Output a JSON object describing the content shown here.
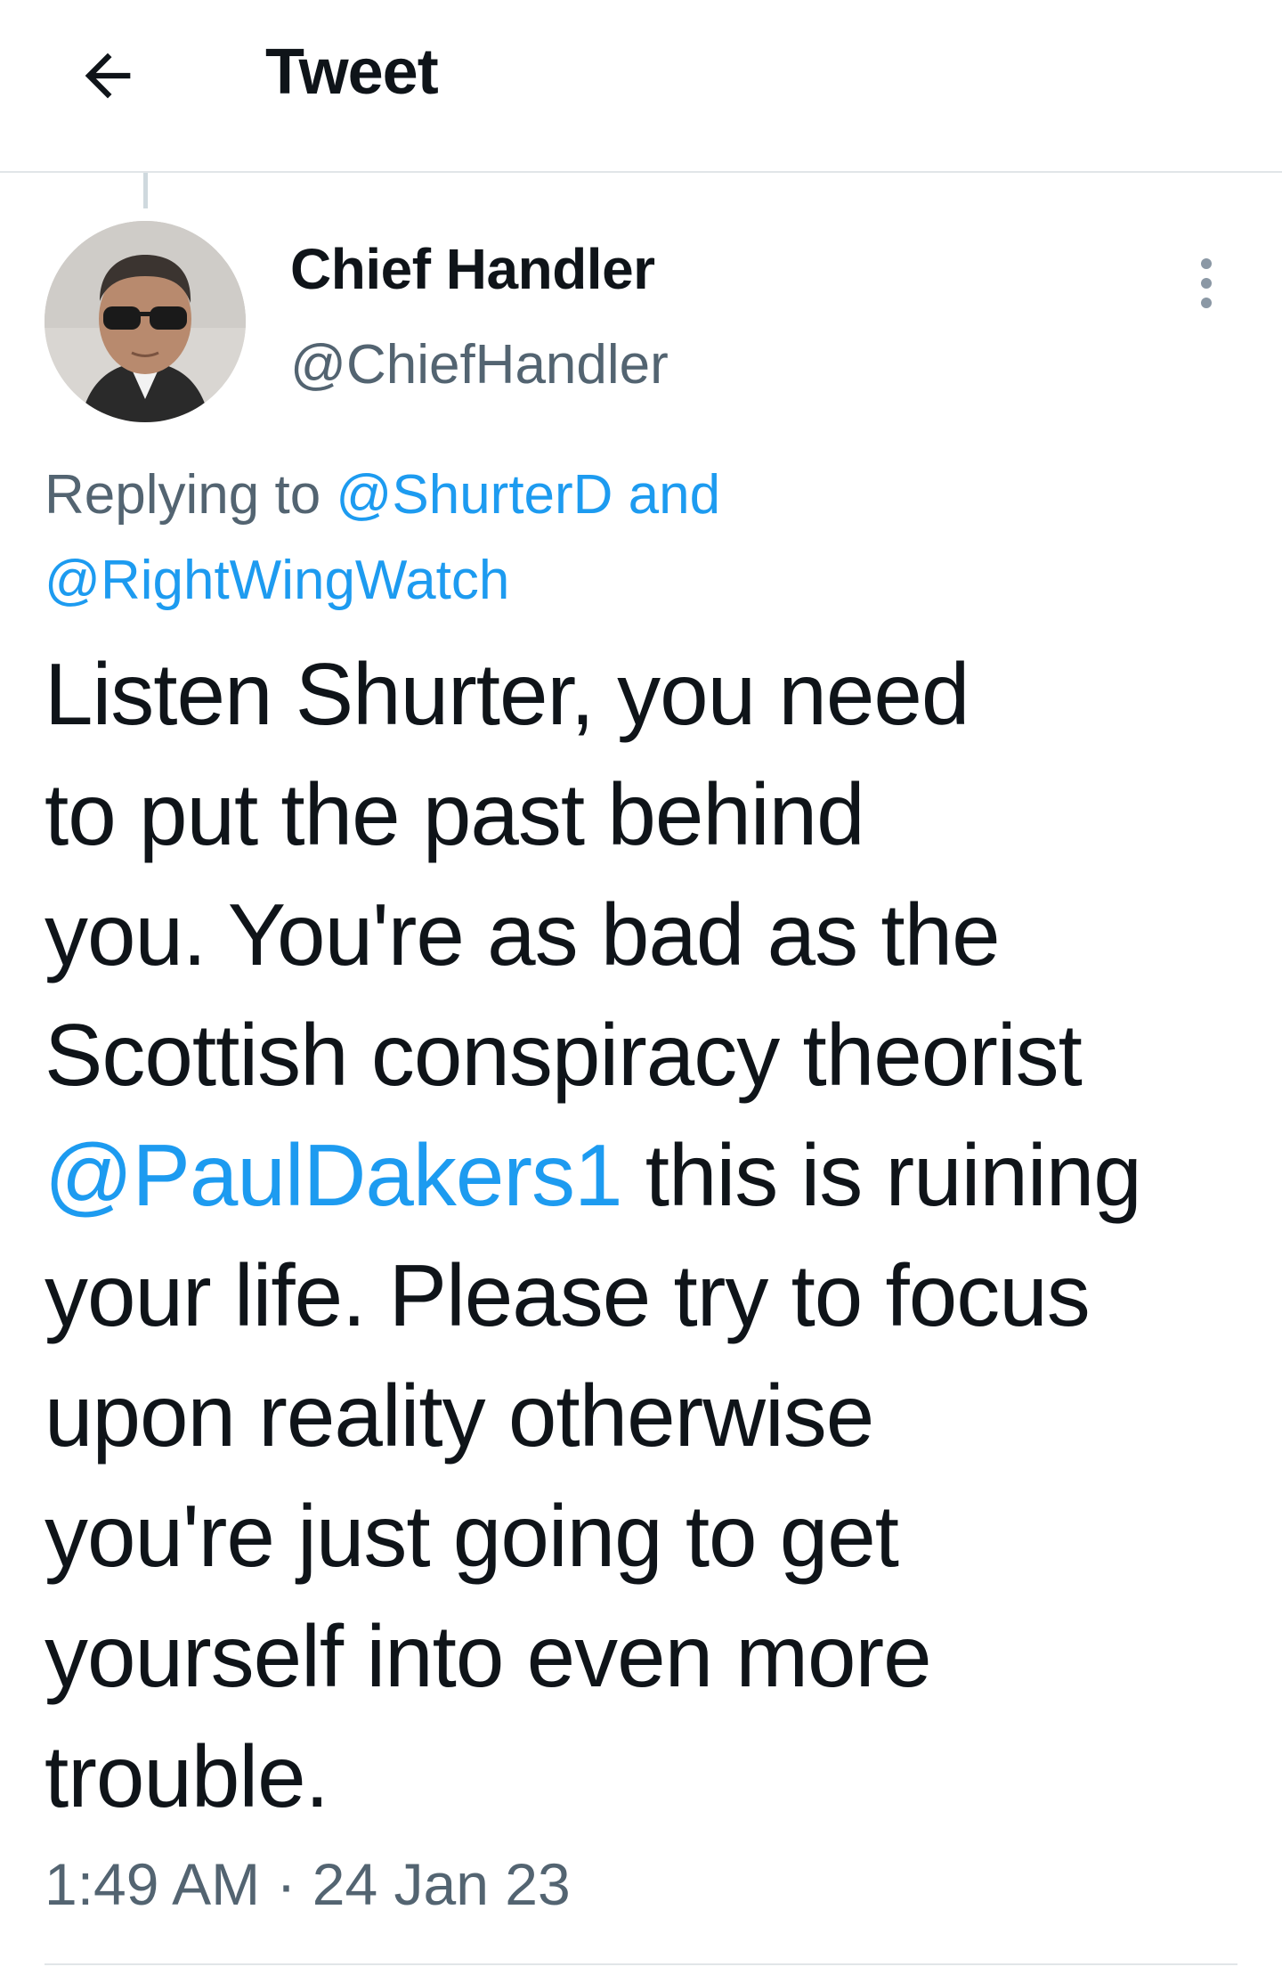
{
  "header": {
    "back_icon": "arrow-left-icon",
    "title": "Tweet"
  },
  "author": {
    "display_name": "Chief Handler",
    "handle": "@ChiefHandler",
    "avatar_icon": "user-avatar"
  },
  "more_icon": "more-vertical-icon",
  "replying": {
    "prefix": "Replying to ",
    "user1": "@ShurterD",
    "joiner": " and",
    "user2": "@RightWingWatch"
  },
  "tweet": {
    "line1": "Listen Shurter, you need",
    "line2": "to put the past behind",
    "line3": "you. You're as bad as the",
    "line4": "Scottish conspiracy theorist",
    "mention": "@PaulDakers1",
    "line5_rest": " this is ruining",
    "line6": "your life. Please try to focus",
    "line7": "upon reality otherwise",
    "line8": "you're just going to get",
    "line9": "yourself into even more",
    "line10": "trouble."
  },
  "timestamp": "1:49 AM · 24 Jan 23",
  "colors": {
    "link": "#1d9bf0",
    "text": "#0f1419",
    "secondary": "#536471"
  }
}
